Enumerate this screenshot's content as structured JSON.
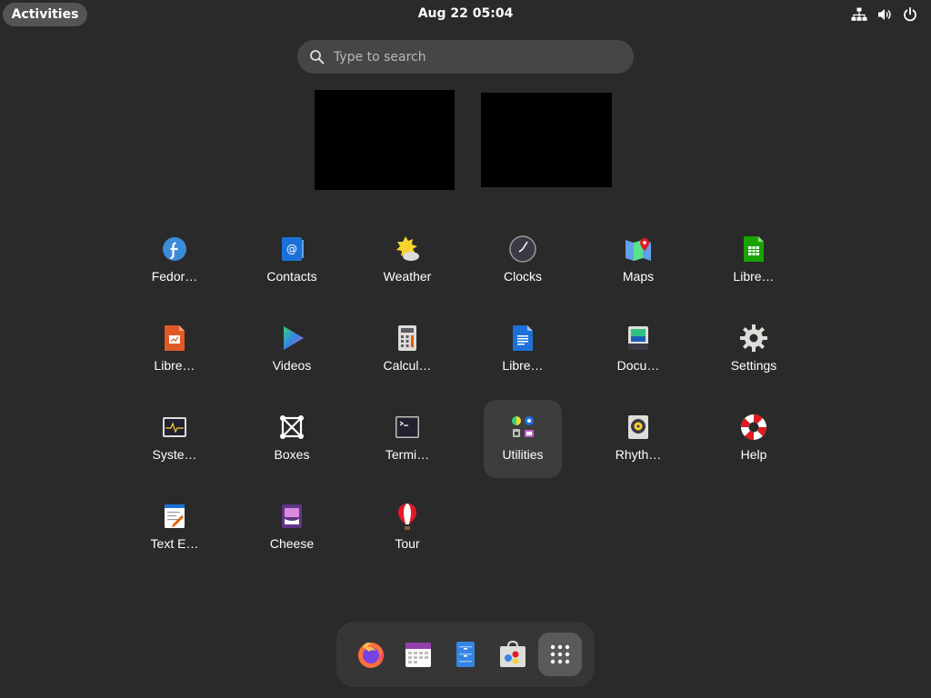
{
  "topbar": {
    "activities_label": "Activities",
    "clock_text": "Aug 22  05:04",
    "tray_icons": [
      "network-icon",
      "volume-icon",
      "power-icon"
    ]
  },
  "search": {
    "placeholder": "Type to search",
    "value": ""
  },
  "apps": [
    {
      "label": "Fedor…",
      "icon": "fedora-icon"
    },
    {
      "label": "Contacts",
      "icon": "contacts-icon"
    },
    {
      "label": "Weather",
      "icon": "weather-icon"
    },
    {
      "label": "Clocks",
      "icon": "clocks-icon"
    },
    {
      "label": "Maps",
      "icon": "maps-icon"
    },
    {
      "label": "Libre…",
      "icon": "libreoffice-calc-icon"
    },
    {
      "label": "Libre…",
      "icon": "libreoffice-impress-icon"
    },
    {
      "label": "Videos",
      "icon": "videos-icon"
    },
    {
      "label": "Calcul…",
      "icon": "calculator-icon"
    },
    {
      "label": "Libre…",
      "icon": "libreoffice-writer-icon"
    },
    {
      "label": "Docu…",
      "icon": "document-scanner-icon"
    },
    {
      "label": "Settings",
      "icon": "settings-gear-icon"
    },
    {
      "label": "Syste…",
      "icon": "system-monitor-icon"
    },
    {
      "label": "Boxes",
      "icon": "boxes-icon"
    },
    {
      "label": "Termi…",
      "icon": "terminal-icon"
    },
    {
      "label": "Utilities",
      "icon": "utilities-folder-icon"
    },
    {
      "label": "Rhyth…",
      "icon": "rhythmbox-icon"
    },
    {
      "label": "Help",
      "icon": "help-lifebuoy-icon"
    },
    {
      "label": "Text E…",
      "icon": "text-editor-icon"
    },
    {
      "label": "Cheese",
      "icon": "cheese-icon"
    },
    {
      "label": "Tour",
      "icon": "tour-balloon-icon"
    }
  ],
  "dash": [
    "firefox-icon",
    "calendar-icon",
    "files-icon",
    "software-icon",
    "show-apps-icon"
  ],
  "colors": {
    "background": "#2a2a2a",
    "highlight": "#3d3d3d",
    "dash": "#363636"
  }
}
